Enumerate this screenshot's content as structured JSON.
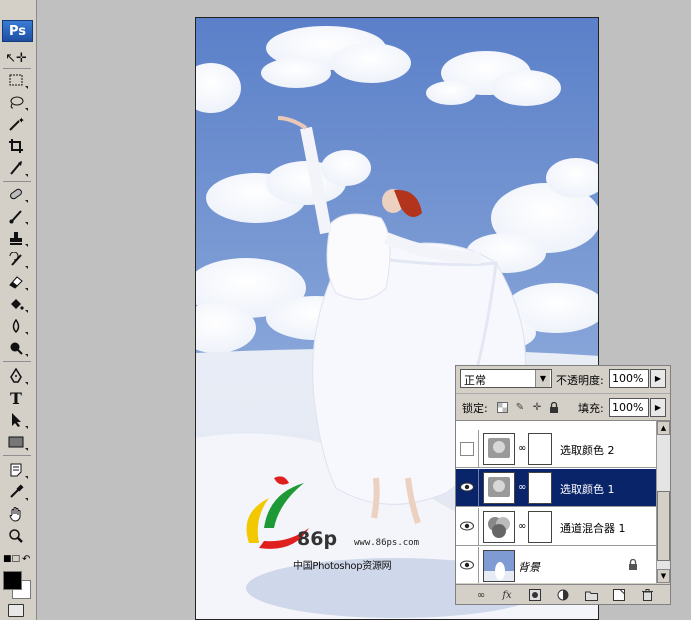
{
  "app": {
    "logo": "Ps",
    "accent": "#0a246a"
  },
  "toolbox": {
    "tools": [
      "move-icon",
      "marquee-icon",
      "lasso-icon",
      "magic-wand-icon",
      "crop-icon",
      "slice-icon",
      "healing-brush-icon",
      "brush-icon",
      "clone-stamp-icon",
      "history-brush-icon",
      "eraser-icon",
      "paint-bucket-icon",
      "blur-icon",
      "dodge-icon",
      "pen-icon",
      "type-icon",
      "path-selection-icon",
      "rectangle-icon",
      "notes-icon",
      "eyedropper-icon",
      "hand-icon",
      "zoom-icon"
    ],
    "type_glyph": "T",
    "foreground_color": "#000000",
    "background_color": "#ffffff"
  },
  "canvas": {
    "watermark_logo": "86p",
    "watermark_url": "www.86ps.com",
    "watermark_caption": "中国Photoshop资源网"
  },
  "layers_panel": {
    "blend_mode": "正常",
    "opacity_label": "不透明度:",
    "opacity_value": "100%",
    "lock_label": "锁定:",
    "fill_label": "填充:",
    "fill_value": "100%",
    "layers": [
      {
        "name": "选取颜色 2",
        "visible": false,
        "selected": false,
        "kind": "adjustment"
      },
      {
        "name": "选取颜色 1",
        "visible": true,
        "selected": true,
        "kind": "adjustment"
      },
      {
        "name": "通道混合器 1",
        "visible": true,
        "selected": false,
        "kind": "adjustment"
      },
      {
        "name": "背景",
        "visible": true,
        "selected": false,
        "kind": "background",
        "locked": true
      }
    ]
  }
}
